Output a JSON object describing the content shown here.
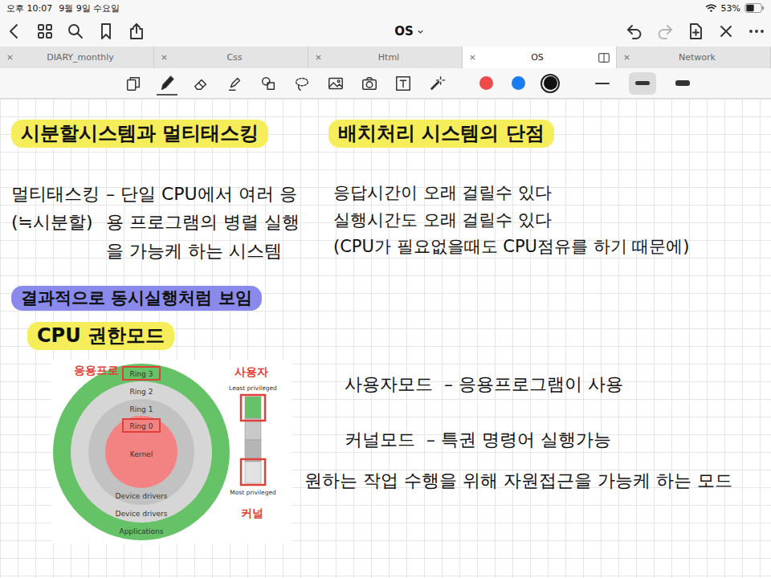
{
  "status_bar": {
    "time": "오후 10:07",
    "date": "9월 9일 수요일",
    "battery": "53%",
    "battery_level": 0.53
  },
  "toolbar": {
    "title": "OS",
    "left_icons": [
      {
        "kind": "back",
        "disabled": false
      },
      {
        "kind": "grid",
        "disabled": false
      },
      {
        "kind": "search",
        "disabled": false
      },
      {
        "kind": "bookmark",
        "disabled": false
      },
      {
        "kind": "share",
        "disabled": false
      }
    ],
    "right_icons": [
      {
        "kind": "undo",
        "disabled": false
      },
      {
        "kind": "redo",
        "disabled": true
      },
      {
        "kind": "add-page",
        "disabled": false
      },
      {
        "kind": "close",
        "disabled": false
      },
      {
        "kind": "more",
        "disabled": false
      }
    ]
  },
  "tabs": [
    {
      "label": "DIARY_monthly",
      "selected": false
    },
    {
      "label": "Css",
      "selected": false
    },
    {
      "label": "Html",
      "selected": false
    },
    {
      "label": "OS",
      "selected": true
    },
    {
      "label": "Network",
      "selected": false
    }
  ],
  "tools": [
    {
      "kind": "page",
      "selected": false
    },
    {
      "kind": "pen",
      "selected": true
    },
    {
      "kind": "eraser",
      "selected": false
    },
    {
      "kind": "highlighter",
      "selected": false
    },
    {
      "kind": "shapes",
      "selected": false
    },
    {
      "kind": "lasso",
      "selected": false
    },
    {
      "kind": "image",
      "selected": false
    },
    {
      "kind": "camera",
      "selected": false
    },
    {
      "kind": "text",
      "selected": false
    },
    {
      "kind": "laser",
      "selected": false
    }
  ],
  "colors": [
    {
      "color": "#f0494a",
      "selected": false
    },
    {
      "color": "#1a7cf2",
      "selected": false
    },
    {
      "color": "#111111",
      "selected": true
    }
  ],
  "widths": [
    {
      "kind": "thin",
      "selected": false
    },
    {
      "kind": "medium",
      "selected": true
    },
    {
      "kind": "thick",
      "selected": false
    }
  ],
  "note": {
    "left": [
      {
        "kind": "heading",
        "text": "시분할시스템과 멀티태스킹",
        "highlight": "#f5ee5a"
      },
      {
        "kind": "definition",
        "term": "멀티태스킹",
        "aside": "(≒시분할)",
        "text": "– 단일 CPU에서 여러 응용 프로그램의 병렬 실행을 가능케 하는 시스템"
      },
      {
        "kind": "heading",
        "text": "결과적으로 동시실행처럼 보임",
        "highlight": "#8a8aec"
      },
      {
        "kind": "heading",
        "text": "CPU 권한모드",
        "highlight": "#f5ee5a"
      }
    ],
    "right": [
      {
        "kind": "heading",
        "text": "배치처리 시스템의 단점",
        "highlight": "#f5ee5a"
      },
      {
        "kind": "line",
        "text": "응답시간이 오래 걸릴수 있다"
      },
      {
        "kind": "line",
        "text": "실행시간도 오래 걸릴수 있다"
      },
      {
        "kind": "line",
        "text": "(CPU가 필요없을때도 CPU점유를 하기 때문에)"
      }
    ],
    "diagram": {
      "rings": [
        {
          "label": "Ring 3",
          "bottom_label": "Applications",
          "color": "#66c266",
          "boxed": true
        },
        {
          "label": "Ring 2",
          "bottom_label": "Device drivers",
          "color": "#d6d6d6",
          "boxed": false
        },
        {
          "label": "Ring 1",
          "bottom_label": "Device drivers",
          "color": "#c2c2c2",
          "boxed": false
        },
        {
          "label": "Ring 0",
          "bottom_label": "Kernel",
          "color": "#f38383",
          "boxed": true
        }
      ],
      "scale": {
        "top": "Least privileged",
        "bottom": "Most privileged",
        "segments": [
          {
            "color": "#66c266"
          },
          {
            "color": "#c8c8c8"
          },
          {
            "color": "#b5b5b5"
          },
          {
            "color": "#e2e2e2"
          }
        ]
      },
      "annotations": {
        "app": "응용프로",
        "user": "사용자",
        "kernel": "커널"
      }
    },
    "modes": [
      {
        "term": "사용자모드",
        "text": "– 응용프로그램이 사용"
      },
      {
        "term": "커널모드",
        "text": "– 특권 명령어 실행가능"
      }
    ],
    "mode_note": "원하는 작업 수행을 위해 자원접근을 가능케 하는 모드"
  }
}
